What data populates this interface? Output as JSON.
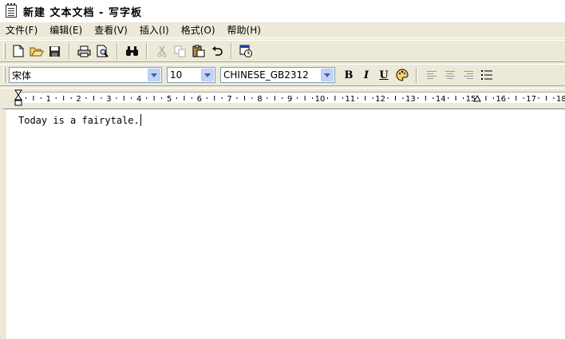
{
  "window": {
    "title": "新建 文本文档 - 写字板"
  },
  "menu": [
    "文件(F)",
    "编辑(E)",
    "查看(V)",
    "插入(I)",
    "格式(O)",
    "帮助(H)"
  ],
  "standard_toolbar": {
    "icons": [
      "new-icon",
      "open-icon",
      "save-icon",
      "print-icon",
      "print-preview-icon",
      "find-icon",
      "cut-icon",
      "copy-icon",
      "paste-icon",
      "undo-icon",
      "insert-datetime-icon"
    ]
  },
  "format_toolbar": {
    "font": "宋体",
    "size": "10",
    "script": "CHINESE_GB2312",
    "bold": "B",
    "italic": "I",
    "underline": "U"
  },
  "ruler": {
    "labels": [
      "1",
      "2",
      "3",
      "4",
      "5",
      "6",
      "7",
      "8",
      "9",
      "10",
      "11",
      "12",
      "13",
      "14",
      "15",
      "16",
      "17",
      "18"
    ]
  },
  "document": {
    "text": "Today is a fairytale."
  }
}
